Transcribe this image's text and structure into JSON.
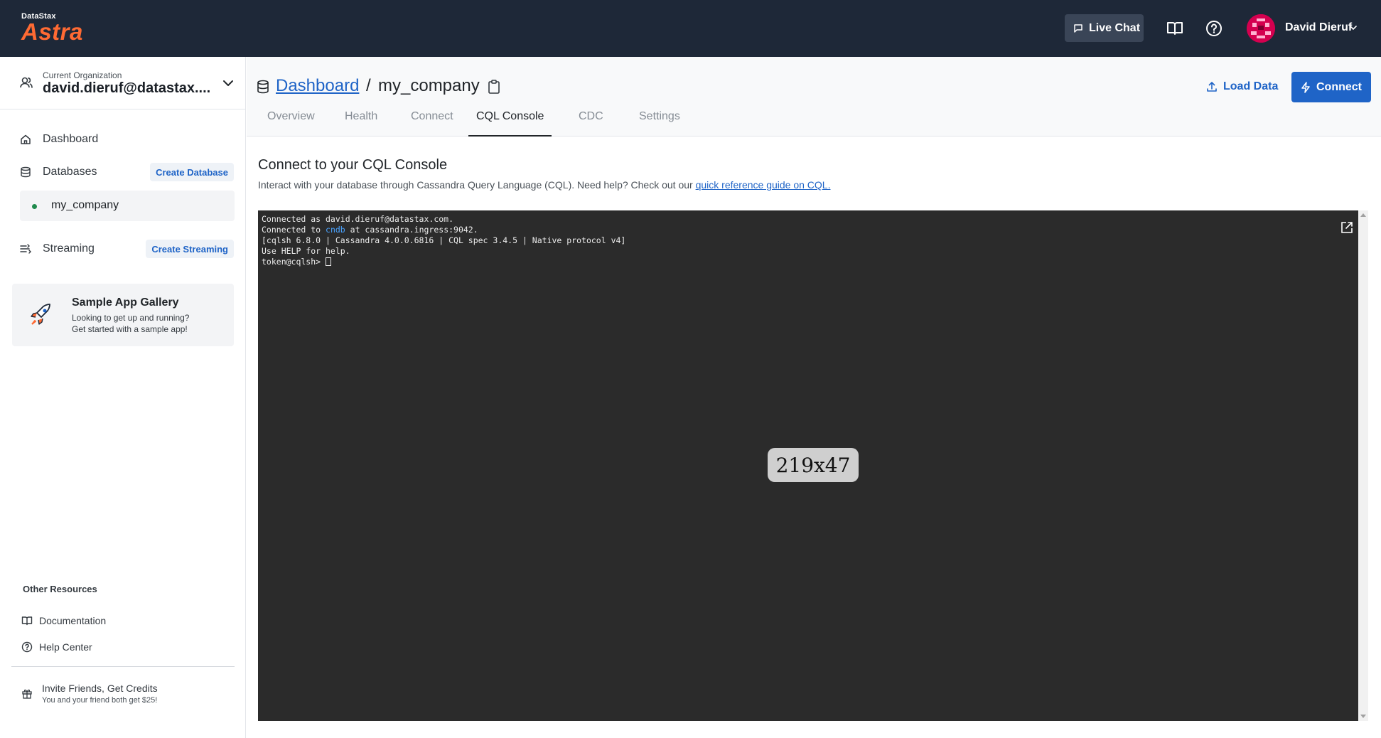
{
  "header": {
    "logo_small": "DataStax",
    "logo_big": "Astra",
    "live_chat_label": "Live Chat",
    "user_name": "David Dieruf"
  },
  "sidebar": {
    "org_caption": "Current Organization",
    "org_name": "david.dieruf@datastax....",
    "nav": {
      "dashboard": "Dashboard",
      "databases": "Databases",
      "create_database": "Create Database",
      "db_item": "my_company",
      "streaming": "Streaming",
      "create_streaming": "Create Streaming"
    },
    "gallery": {
      "title": "Sample App Gallery",
      "line1": "Looking to get up and running?",
      "line2": "Get started with a sample app!"
    },
    "resources": {
      "title": "Other Resources",
      "documentation": "Documentation",
      "help_center": "Help Center"
    },
    "invite": {
      "title": "Invite Friends, Get Credits",
      "subtitle": "You and your friend both get $25!"
    }
  },
  "main": {
    "breadcrumb_link": "Dashboard",
    "breadcrumb_sep": "/",
    "breadcrumb_current": "my_company",
    "load_data_label": "Load Data",
    "connect_label": "Connect",
    "tabs": [
      {
        "label": "Overview"
      },
      {
        "label": "Health"
      },
      {
        "label": "Connect"
      },
      {
        "label": "CQL Console"
      },
      {
        "label": "CDC"
      },
      {
        "label": "Settings"
      }
    ],
    "console_title": "Connect to your CQL Console",
    "console_desc": "Interact with your database through Cassandra Query Language (CQL). Need help? Check out our",
    "console_link": "quick reference guide on CQL."
  },
  "terminal": {
    "line1": "Connected as david.dieruf@datastax.com.",
    "line2_pre": "Connected to ",
    "line2_hl": "cndb",
    "line2_post": " at cassandra.ingress:9042.",
    "line3": "[cqlsh 6.8.0 | Cassandra 4.0.0.6816 | CQL spec 3.4.5 | Native protocol v4]",
    "line4": "Use HELP for help.",
    "prompt": "token@cqlsh> ",
    "size_badge": "219x47"
  },
  "colors": {
    "header_bg": "#1e2838",
    "brand_orange": "#ff6a33",
    "accent_blue": "#1f64c7",
    "terminal_bg": "#2b2b2b",
    "status_green": "#1f8a4c"
  }
}
